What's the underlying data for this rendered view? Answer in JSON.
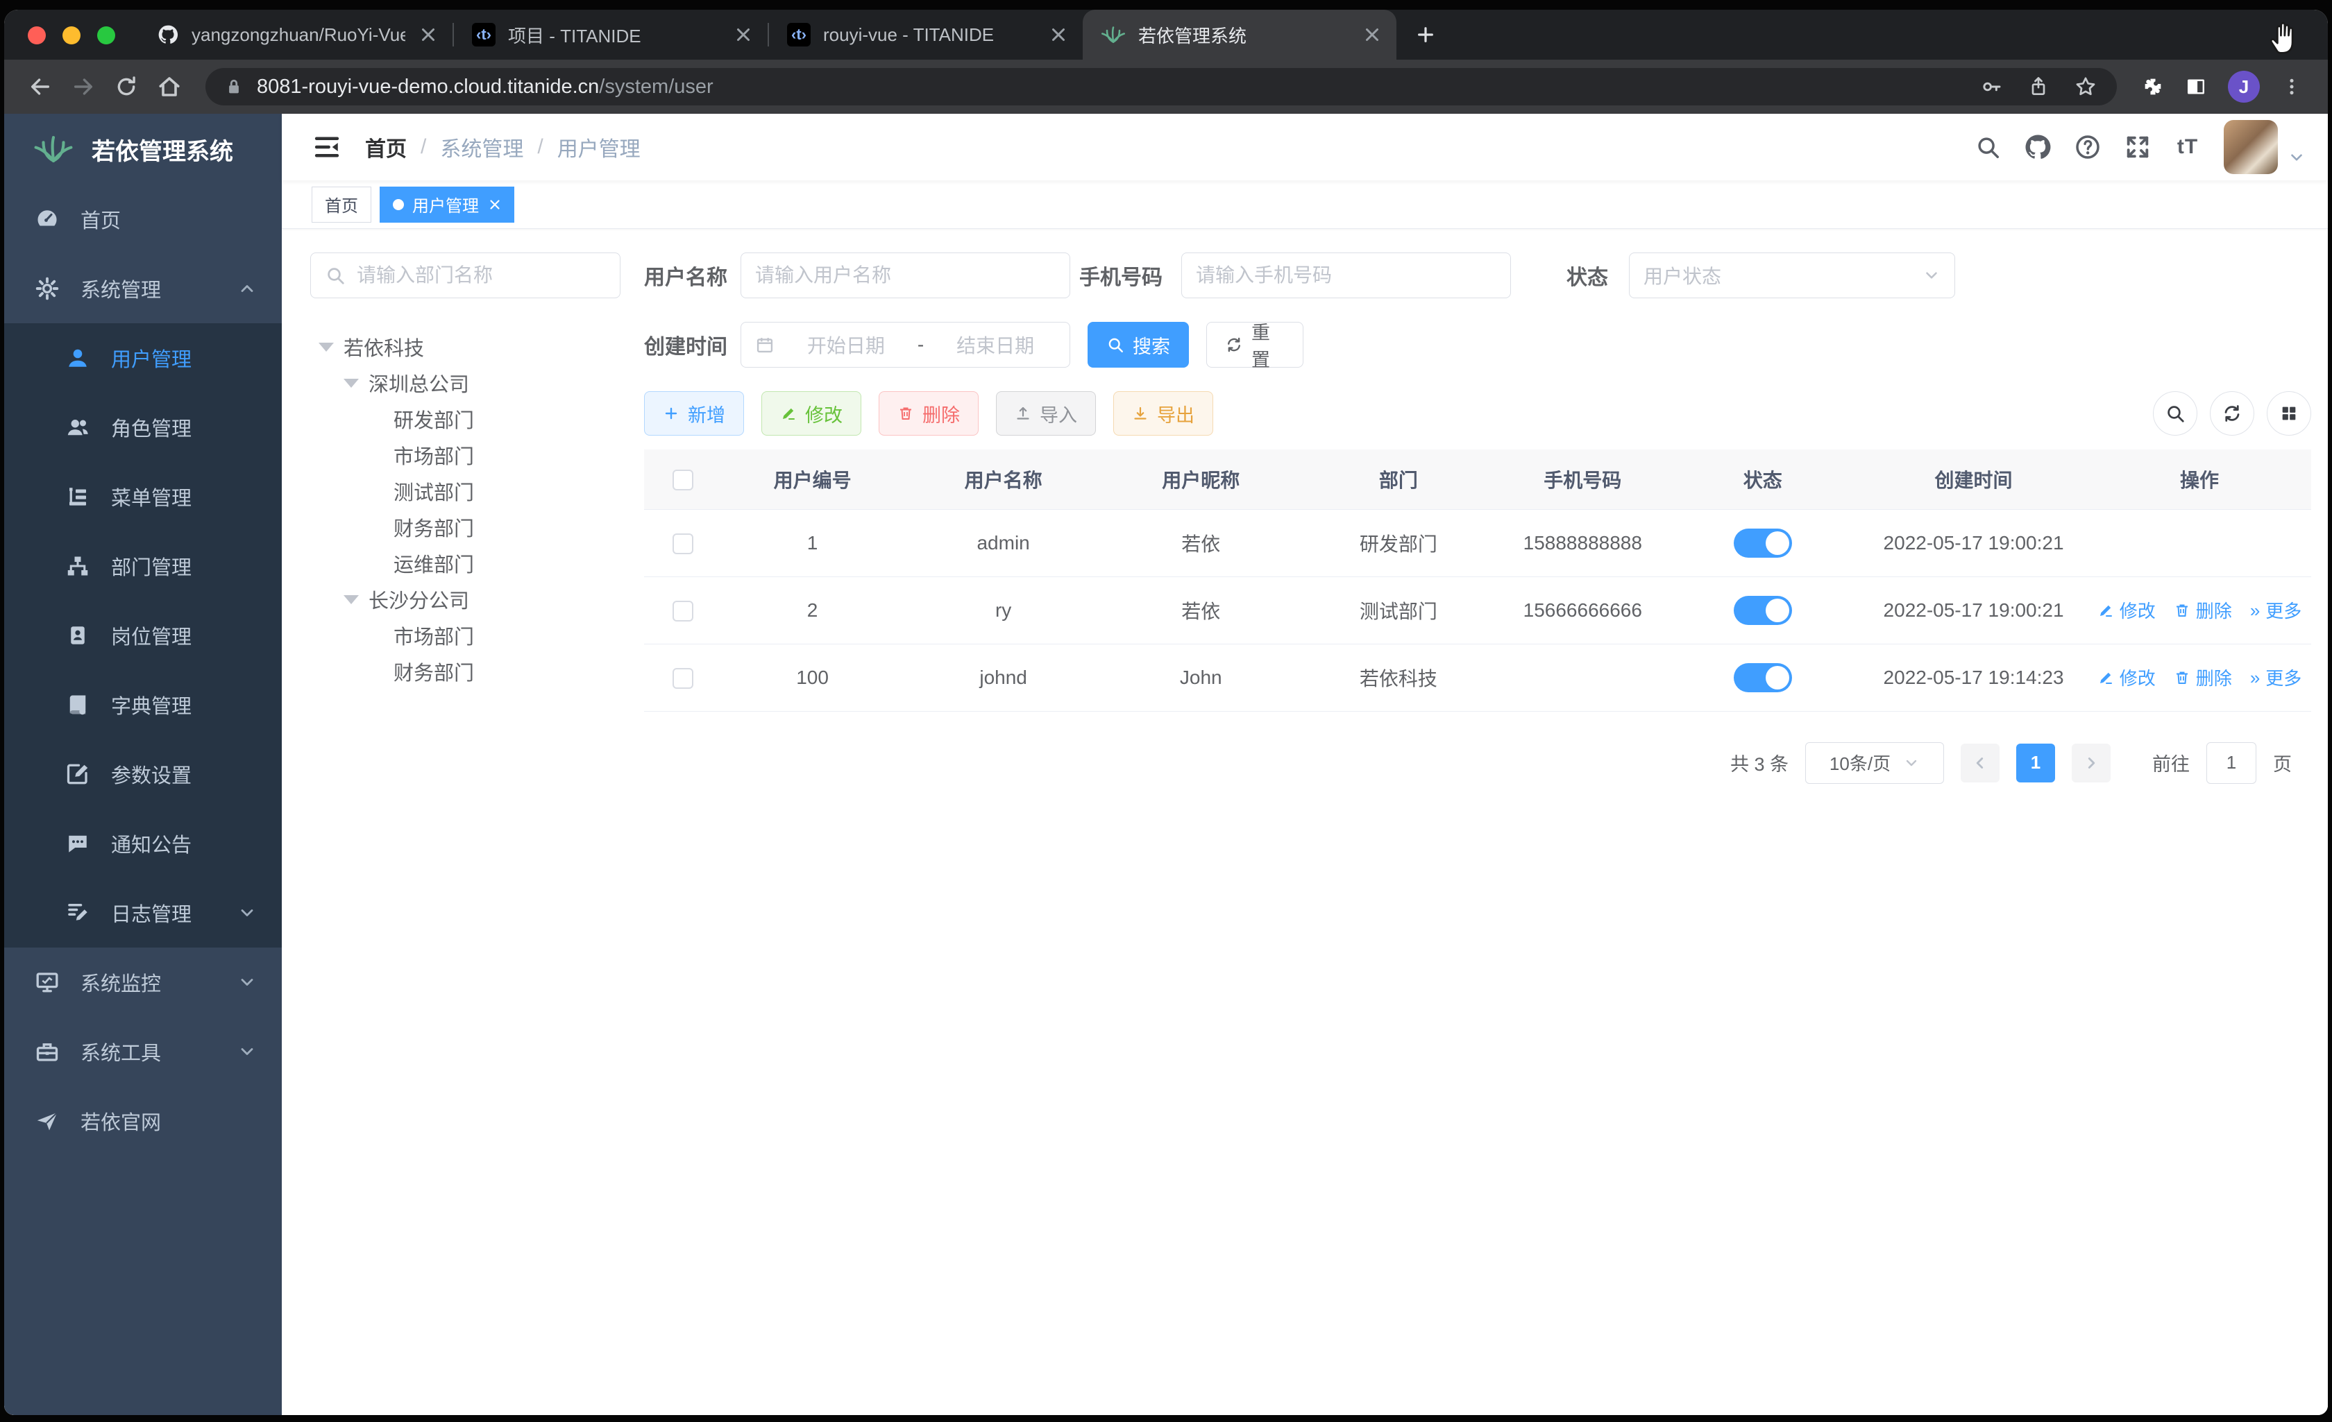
{
  "chrome": {
    "tabs": [
      {
        "title": "yangzongzhuan/RuoYi-Vue: (R",
        "icon": "github-icon"
      },
      {
        "title": "项目 - TITANIDE",
        "icon": "titanide-icon"
      },
      {
        "title": "rouyi-vue - TITANIDE",
        "icon": "titanide-icon"
      },
      {
        "title": "若依管理系统",
        "icon": "ruoyi-leaf-icon"
      }
    ],
    "titanide_glyph": "‹t›",
    "url": {
      "host": "8081-rouyi-vue-demo.cloud.titanide.cn",
      "path": "/system/user"
    },
    "profile_initial": "J"
  },
  "sidebar": {
    "logo_title": "若依管理系统",
    "items": [
      {
        "label": "首页"
      },
      {
        "label": "系统管理"
      },
      {
        "label": "用户管理"
      },
      {
        "label": "角色管理"
      },
      {
        "label": "菜单管理"
      },
      {
        "label": "部门管理"
      },
      {
        "label": "岗位管理"
      },
      {
        "label": "字典管理"
      },
      {
        "label": "参数设置"
      },
      {
        "label": "通知公告"
      },
      {
        "label": "日志管理"
      },
      {
        "label": "系统监控"
      },
      {
        "label": "系统工具"
      },
      {
        "label": "若依官网"
      }
    ]
  },
  "header": {
    "breadcrumb": [
      "首页",
      "系统管理",
      "用户管理"
    ],
    "separator": "/",
    "font_size_icon_text": "tT"
  },
  "tags": [
    {
      "label": "首页"
    },
    {
      "label": "用户管理"
    }
  ],
  "dept_tree": {
    "search_placeholder": "请输入部门名称",
    "nodes": [
      {
        "label": "若依科技"
      },
      {
        "label": "深圳总公司"
      },
      {
        "label": "研发部门"
      },
      {
        "label": "市场部门"
      },
      {
        "label": "测试部门"
      },
      {
        "label": "财务部门"
      },
      {
        "label": "运维部门"
      },
      {
        "label": "长沙分公司"
      },
      {
        "label": "市场部门"
      },
      {
        "label": "财务部门"
      }
    ]
  },
  "filters": {
    "username_label": "用户名称",
    "username_placeholder": "请输入用户名称",
    "phone_label": "手机号码",
    "phone_placeholder": "请输入手机号码",
    "status_label": "状态",
    "status_placeholder": "用户状态",
    "created_label": "创建时间",
    "date_start_placeholder": "开始日期",
    "date_separator": "-",
    "date_end_placeholder": "结束日期",
    "search_button": "搜索",
    "reset_button": "重置"
  },
  "toolbar": {
    "add": "新增",
    "edit": "修改",
    "delete": "删除",
    "import": "导入",
    "export": "导出"
  },
  "table": {
    "headers": [
      "用户编号",
      "用户名称",
      "用户昵称",
      "部门",
      "手机号码",
      "状态",
      "创建时间",
      "操作"
    ],
    "action_labels": {
      "edit": "修改",
      "delete": "删除",
      "more": "更多",
      "more_glyph": "»"
    },
    "rows": [
      {
        "id": "1",
        "username": "admin",
        "nickname": "若依",
        "dept": "研发部门",
        "phone": "15888888888",
        "created": "2022-05-17 19:00:21"
      },
      {
        "id": "2",
        "username": "ry",
        "nickname": "若依",
        "dept": "测试部门",
        "phone": "15666666666",
        "created": "2022-05-17 19:00:21"
      },
      {
        "id": "100",
        "username": "johnd",
        "nickname": "John",
        "dept": "若依科技",
        "phone": "",
        "created": "2022-05-17 19:14:23"
      }
    ]
  },
  "pagination": {
    "total_text": "共 3 条",
    "page_size": "10条/页",
    "current_page": "1",
    "goto_label": "前往",
    "goto_value": "1",
    "page_suffix": "页"
  },
  "colors": {
    "primary": "#409EFF",
    "success": "#67C23A",
    "danger": "#F56C6C",
    "warning": "#E6A23C",
    "sidebar": "#36455a",
    "submenu": "#263444"
  }
}
